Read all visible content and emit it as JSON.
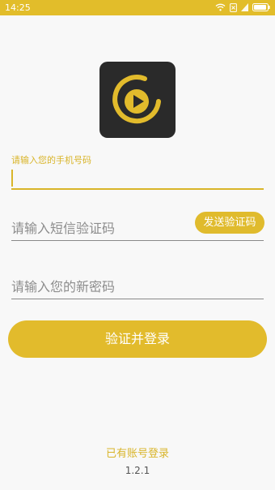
{
  "status_bar": {
    "time": "14:25",
    "icons": [
      "wifi-icon",
      "sim-icon",
      "signal-icon",
      "battery-icon"
    ],
    "background": "#e2bd2a"
  },
  "logo": {
    "icon": "play-logo-icon",
    "background": "#2a2a2a",
    "accent": "#e2bb2c"
  },
  "form": {
    "phone_label": "请输入您的手机号码",
    "phone_value": "",
    "code_placeholder": "请输入短信验证码",
    "send_code_label": "发送验证码",
    "password_placeholder": "请输入您的新密码",
    "submit_label": "验证并登录"
  },
  "footer": {
    "login_link": "已有账号登录",
    "version": "1.2.1"
  },
  "colors": {
    "accent": "#e2bb2c",
    "text_muted": "#8d8d8d"
  }
}
